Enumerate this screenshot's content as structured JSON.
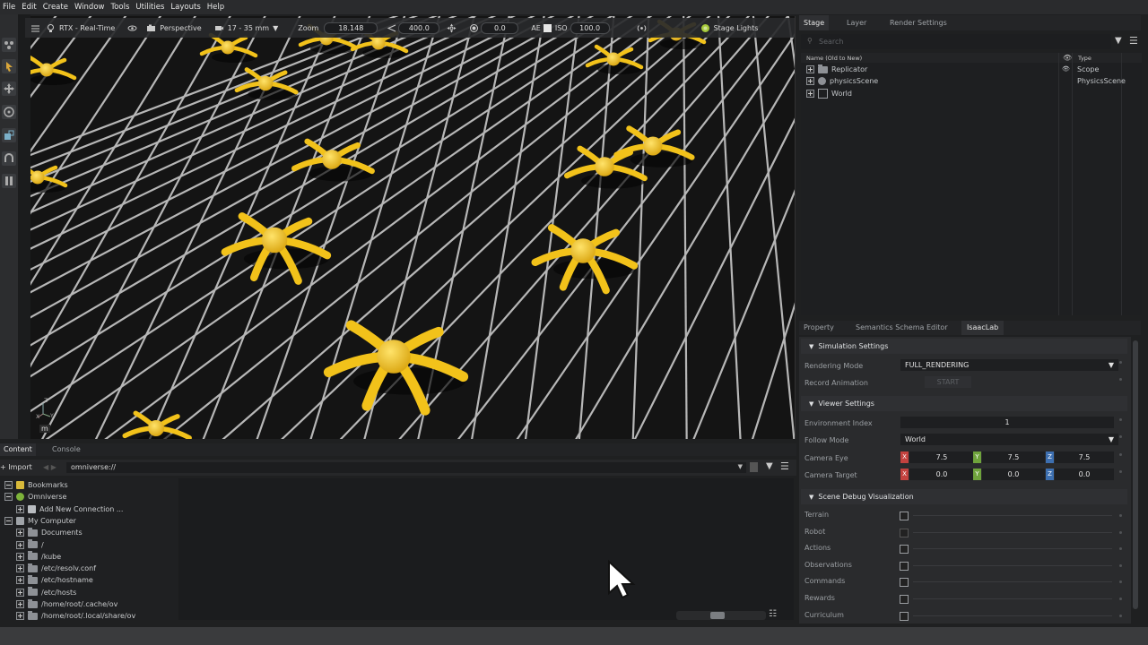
{
  "menubar": [
    "File",
    "Edit",
    "Create",
    "Window",
    "Tools",
    "Utilities",
    "Layouts",
    "Help"
  ],
  "viewport_toolbar": {
    "renderer": "RTX - Real-Time",
    "camera": "Perspective",
    "lens": "17 - 35 mm",
    "zoom_label": "Zoom",
    "zoom_value": "18.148",
    "distance_value": "400.0",
    "exposure_value": "0.0",
    "ae_label": "AE",
    "iso_label": "ISO",
    "iso_value": "100.0",
    "stage_lights": "Stage Lights"
  },
  "viewport": {
    "unit_label": "m",
    "axis_x": "X",
    "axis_y": "Y",
    "axis_z": "Z"
  },
  "content": {
    "tabs": [
      "Content",
      "Console"
    ],
    "import_label": "Import",
    "path": "omniverse://",
    "tree": [
      {
        "label": "Bookmarks",
        "kind": "bookmark",
        "indent": 0,
        "expander": "minus"
      },
      {
        "label": "Omniverse",
        "kind": "omni",
        "indent": 0,
        "expander": "minus"
      },
      {
        "label": "Add New Connection ...",
        "kind": "connection",
        "indent": 1,
        "expander": "plus"
      },
      {
        "label": "My Computer",
        "kind": "computer",
        "indent": 0,
        "expander": "minus"
      },
      {
        "label": "Documents",
        "kind": "folder",
        "indent": 1,
        "expander": "plus"
      },
      {
        "label": "/",
        "kind": "folder",
        "indent": 1,
        "expander": "plus"
      },
      {
        "label": "/kube",
        "kind": "folder",
        "indent": 1,
        "expander": "plus"
      },
      {
        "label": "/etc/resolv.conf",
        "kind": "folder",
        "indent": 1,
        "expander": "plus"
      },
      {
        "label": "/etc/hostname",
        "kind": "folder",
        "indent": 1,
        "expander": "plus"
      },
      {
        "label": "/etc/hosts",
        "kind": "folder",
        "indent": 1,
        "expander": "plus"
      },
      {
        "label": "/home/root/.cache/ov",
        "kind": "folder",
        "indent": 1,
        "expander": "plus"
      },
      {
        "label": "/home/root/.local/share/ov",
        "kind": "folder",
        "indent": 1,
        "expander": "plus"
      }
    ]
  },
  "stage": {
    "tabs": [
      "Stage",
      "Layer",
      "Render Settings"
    ],
    "search_placeholder": "Search",
    "col_name": "Name (Old to New)",
    "col_type": "Type",
    "rows": [
      {
        "name": "Replicator",
        "type": "Scope",
        "kind": "folder"
      },
      {
        "name": "physicsScene",
        "type": "PhysicsScene",
        "kind": "physics"
      },
      {
        "name": "World",
        "type": "",
        "kind": "xform"
      }
    ]
  },
  "property": {
    "tabs": [
      "Property",
      "Semantics Schema Editor",
      "IsaacLab"
    ],
    "sim_section": "Simulation Settings",
    "rendering_mode_label": "Rendering Mode",
    "rendering_mode_value": "FULL_RENDERING",
    "record_label": "Record Animation",
    "record_button": "START",
    "viewer_section": "Viewer Settings",
    "env_index_label": "Environment Index",
    "env_index_value": "1",
    "follow_label": "Follow Mode",
    "follow_value": "World",
    "eye_label": "Camera Eye",
    "eye": {
      "x": "7.5",
      "y": "7.5",
      "z": "7.5"
    },
    "target_label": "Camera Target",
    "target": {
      "x": "0.0",
      "y": "0.0",
      "z": "0.0"
    },
    "axis_labels": {
      "x": "X",
      "y": "Y",
      "z": "Z"
    },
    "debug_section": "Scene Debug Visualization",
    "debug_items": [
      "Terrain",
      "Robot",
      "Actions",
      "Observations",
      "Commands",
      "Rewards",
      "Curriculum"
    ]
  },
  "colors": {
    "robot": "#f2c21a",
    "x_axis": "#c4423f",
    "y_axis": "#6fa33c",
    "z_axis": "#3d6fb0"
  }
}
